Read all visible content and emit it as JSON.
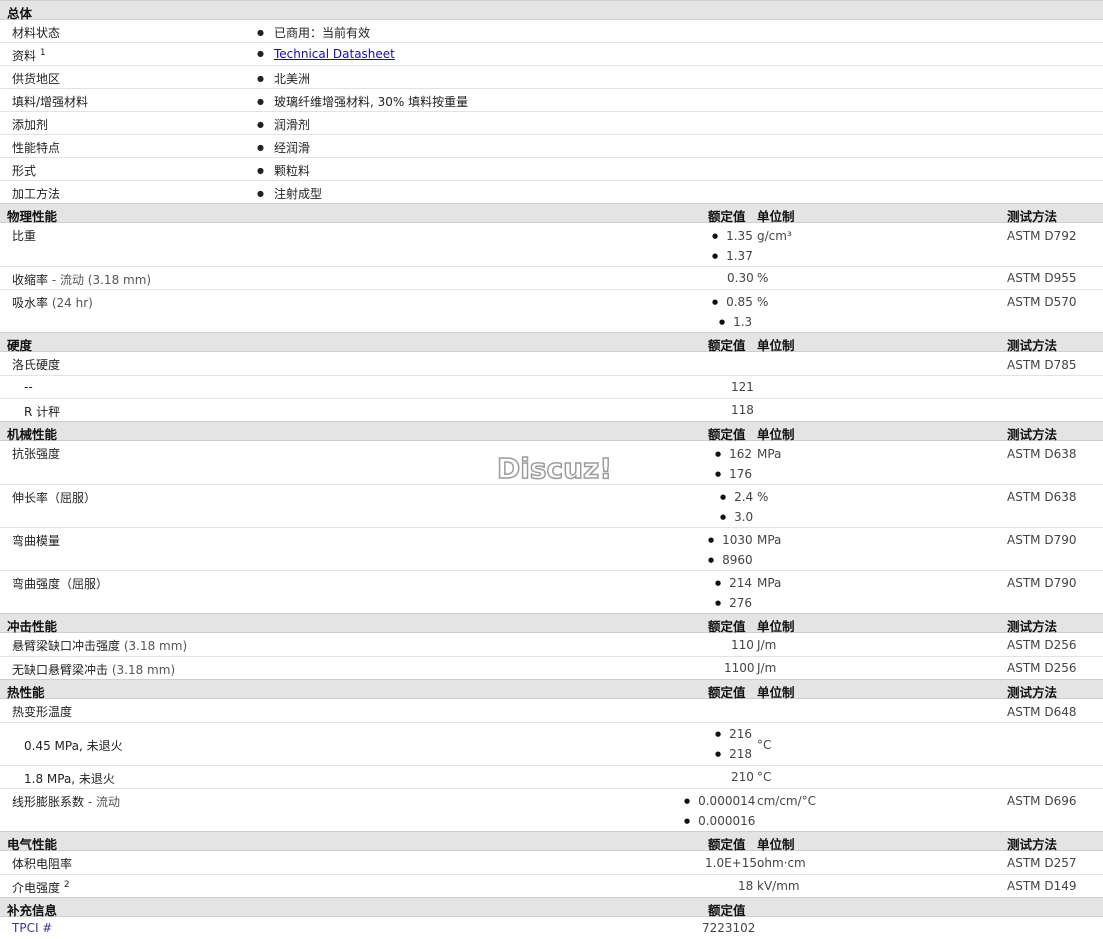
{
  "col_headers": {
    "value": "额定值",
    "unit": "单位制",
    "method": "测试方法"
  },
  "general": {
    "title": "总体",
    "rows": [
      {
        "label": "材料状态",
        "value": "已商用：当前有效"
      },
      {
        "label": "资料",
        "sup": "1",
        "value": "Technical Datasheet"
      },
      {
        "label": "供货地区",
        "value": "北美洲"
      },
      {
        "label": "填料/增强材料",
        "value": "玻璃纤维增强材料, 30% 填料按重量"
      },
      {
        "label": "添加剂",
        "value": "润滑剂"
      },
      {
        "label": "性能特点",
        "value": "经润滑"
      },
      {
        "label": "形式",
        "value": "颗粒料"
      },
      {
        "label": "加工方法",
        "value": "注射成型"
      }
    ]
  },
  "physical": {
    "title": "物理性能",
    "rows": [
      {
        "label": "比重",
        "values": [
          "1.35",
          "1.37"
        ],
        "unit": "g/cm³",
        "method": "ASTM D792"
      },
      {
        "label": "收缩率",
        "label_note": "- 流动 (3.18 mm)",
        "value": "0.30",
        "unit": "%",
        "method": "ASTM D955"
      },
      {
        "label": "吸水率",
        "label_note": "(24 hr)",
        "values": [
          "0.85",
          "1.3"
        ],
        "unit": "%",
        "method": "ASTM D570"
      }
    ]
  },
  "hardness": {
    "title": "硬度",
    "rows": [
      {
        "label": "洛氏硬度",
        "method": "ASTM D785"
      },
      {
        "label": "--",
        "value": "121"
      },
      {
        "label": "R 计秤",
        "value": "118"
      }
    ]
  },
  "mechanical": {
    "title": "机械性能",
    "rows": [
      {
        "label": "抗张强度",
        "values": [
          "162",
          "176"
        ],
        "unit": "MPa",
        "method": "ASTM D638"
      },
      {
        "label": "伸长率（屈服）",
        "values": [
          "2.4",
          "3.0"
        ],
        "unit": "%",
        "method": "ASTM D638"
      },
      {
        "label": "弯曲模量",
        "values": [
          "1030",
          "8960"
        ],
        "unit": "MPa",
        "method": "ASTM D790"
      },
      {
        "label": "弯曲强度（屈服）",
        "values": [
          "214",
          "276"
        ],
        "unit": "MPa",
        "method": "ASTM D790"
      }
    ]
  },
  "impact": {
    "title": "冲击性能",
    "rows": [
      {
        "label": "悬臂梁缺口冲击强度",
        "label_note": "(3.18 mm)",
        "value": "110",
        "unit": "J/m",
        "method": "ASTM D256"
      },
      {
        "label": "无缺口悬臂梁冲击",
        "label_note": "(3.18 mm)",
        "value": "1100",
        "unit": "J/m",
        "method": "ASTM D256"
      }
    ]
  },
  "thermal": {
    "title": "热性能",
    "rows": [
      {
        "label": "热变形温度",
        "method": "ASTM D648"
      },
      {
        "label": "0.45 MPa, 未退火",
        "values": [
          "216",
          "218"
        ],
        "unit": "°C"
      },
      {
        "label": "1.8 MPa, 未退火",
        "value": "210",
        "unit": "°C"
      },
      {
        "label": "线形膨胀系数",
        "label_note": "- 流动",
        "values": [
          "0.000014",
          "0.000016"
        ],
        "unit": "cm/cm/°C",
        "method": "ASTM D696"
      }
    ]
  },
  "electrical": {
    "title": "电气性能",
    "rows": [
      {
        "label": "体积电阻率",
        "value": "1.0E+15",
        "unit": "ohm·cm",
        "method": "ASTM D257"
      },
      {
        "label": "介电强度",
        "sup": "2",
        "value": "18",
        "unit": "kV/mm",
        "method": "ASTM D149"
      }
    ]
  },
  "supplement": {
    "title": "补充信息",
    "rows": [
      {
        "label": "TPCI #",
        "value": "7223102"
      }
    ]
  },
  "watermark": "Discuz!"
}
